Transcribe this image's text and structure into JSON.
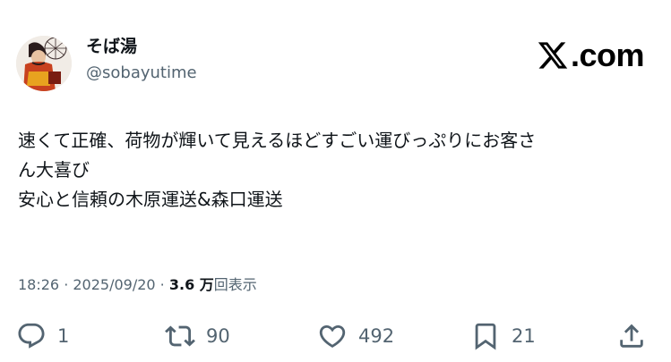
{
  "author": {
    "display_name": "そば湯",
    "handle": "@sobayutime"
  },
  "brand": {
    "name": ".com",
    "icon": "x-logo-icon"
  },
  "tweet": {
    "lines": [
      "速くて正確、荷物が輝いて見えるほどすごい運びっぷりにお客さ",
      "ん大喜び",
      "安心と信頼の木原運送&森口運送"
    ]
  },
  "meta": {
    "time": "18:26",
    "separator": " · ",
    "date": "2025/09/20",
    "views_count": "3.6 万",
    "views_label": "回表示"
  },
  "actions": {
    "reply": {
      "icon": "reply-icon",
      "count": "1"
    },
    "retweet": {
      "icon": "retweet-icon",
      "count": "90"
    },
    "like": {
      "icon": "heart-icon",
      "count": "492"
    },
    "bookmark": {
      "icon": "bookmark-icon",
      "count": "21"
    },
    "share": {
      "icon": "share-icon"
    }
  },
  "colors": {
    "text_primary": "#0f1419",
    "text_secondary": "#536471",
    "background": "#ffffff"
  }
}
